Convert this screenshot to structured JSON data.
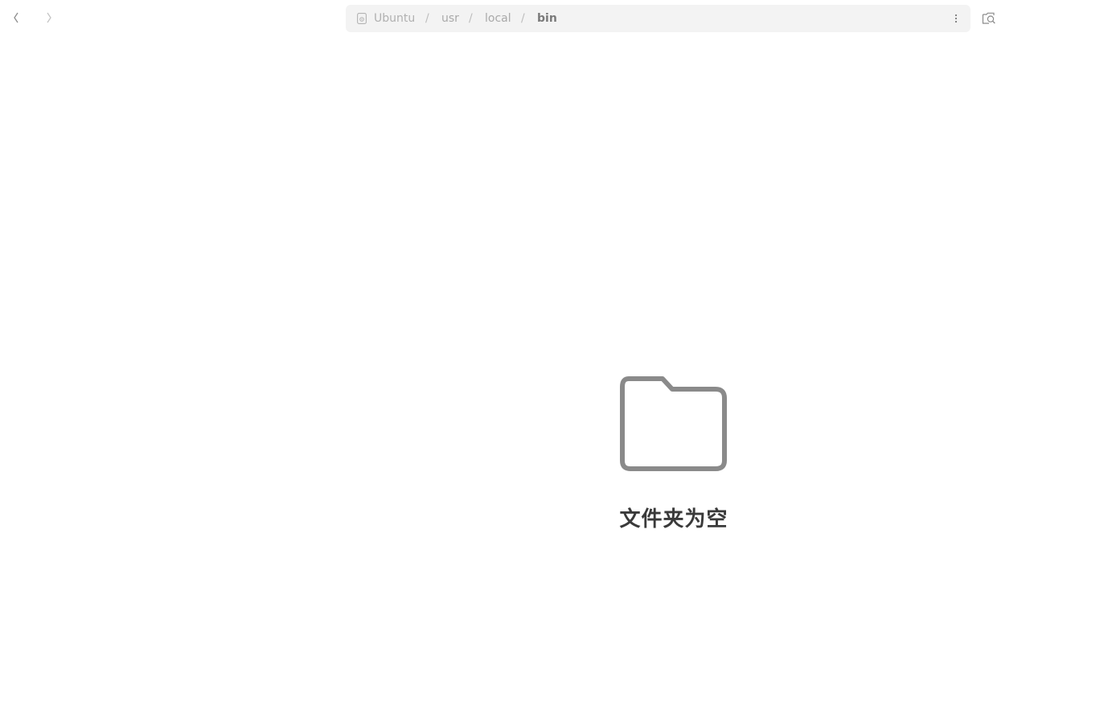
{
  "header": {
    "nav": {
      "back_icon": "chevron-left-icon",
      "forward_icon": "chevron-right-icon"
    },
    "path": {
      "items": [
        {
          "label": "Ubuntu",
          "icon": "drive-icon"
        },
        {
          "label": "usr"
        },
        {
          "label": "local"
        },
        {
          "label": "bin"
        }
      ],
      "separator": "/",
      "menu_icon": "vertical-dots-icon"
    },
    "search_icon": "search-icon"
  },
  "main": {
    "empty_state": {
      "icon": "folder-icon",
      "title": "文件夹为空"
    }
  },
  "colors": {
    "pathbar_bg": "#f3f3f3",
    "icon_gray": "#8a8a8a",
    "title_text": "#3a3a3a"
  }
}
